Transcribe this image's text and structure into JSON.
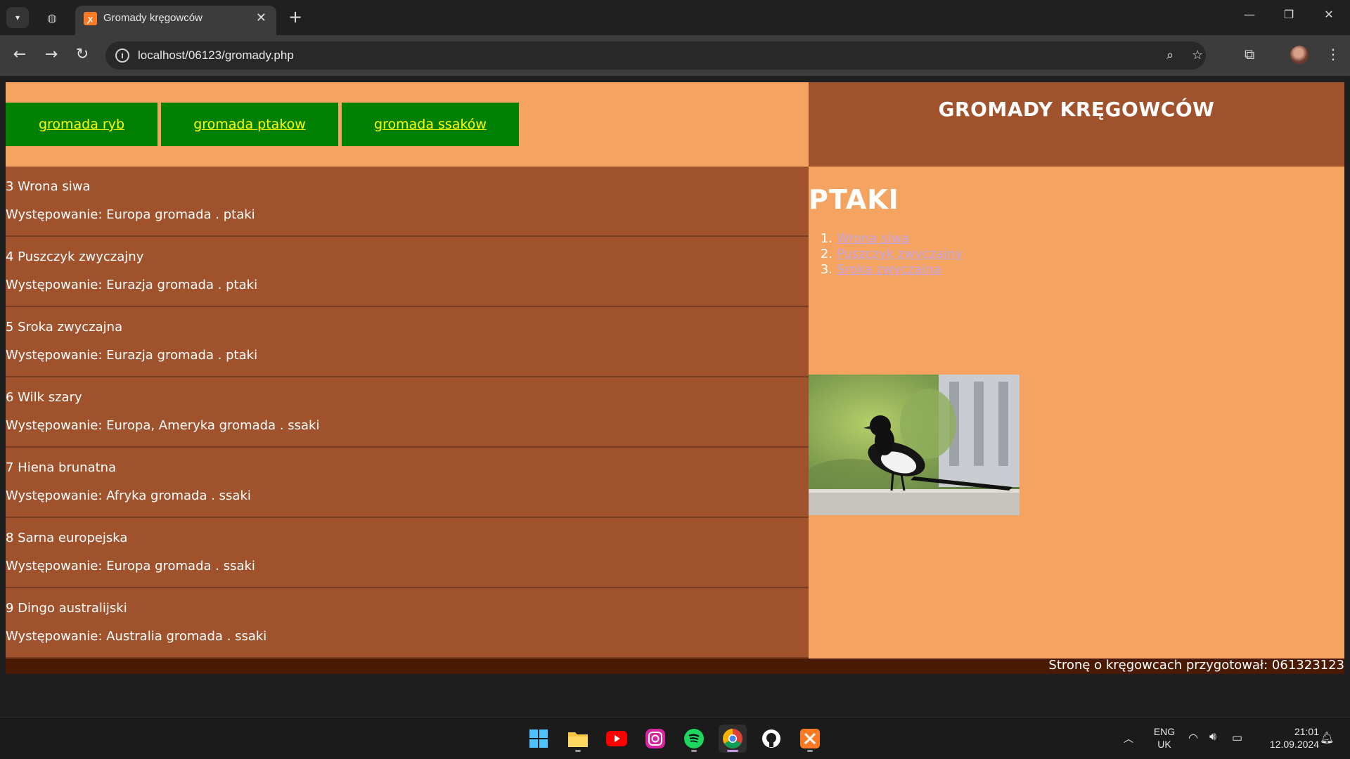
{
  "browser": {
    "tab_title": "Gromady kręgowców",
    "url": "localhost/06123/gromady.php"
  },
  "menu": [
    {
      "label": "gromada ryb"
    },
    {
      "label": "gromada ptakow"
    },
    {
      "label": "gromada ssaków"
    }
  ],
  "header": {
    "title": "GROMADY KRĘGOWCÓW"
  },
  "records": [
    {
      "name": "3 Wrona siwa",
      "desc": "Występowanie: Europa gromada . ptaki"
    },
    {
      "name": "4 Puszczyk zwyczajny",
      "desc": "Występowanie: Eurazja gromada . ptaki"
    },
    {
      "name": "5 Sroka zwyczajna",
      "desc": "Występowanie: Eurazja gromada . ptaki"
    },
    {
      "name": "6 Wilk szary",
      "desc": "Występowanie: Europa, Ameryka gromada . ssaki"
    },
    {
      "name": "7 Hiena brunatna",
      "desc": "Występowanie: Afryka gromada . ssaki"
    },
    {
      "name": "8 Sarna europejska",
      "desc": "Występowanie: Europa gromada . ssaki"
    },
    {
      "name": "9 Dingo australijski",
      "desc": "Występowanie: Australia gromada . ssaki"
    }
  ],
  "section": {
    "heading": "PTAKI",
    "items": [
      {
        "num": "1.",
        "label": "Wrona siwa"
      },
      {
        "num": "2.",
        "label": "Puszczyk zwyczajny"
      },
      {
        "num": "3.",
        "label": "Sroka zwyczajna"
      }
    ]
  },
  "footer": {
    "text": "Stronę o kręgowcach przygotował: 061323123"
  },
  "taskbar": {
    "lang_top": "ENG",
    "lang_bottom": "UK",
    "time": "21:01",
    "date": "12.09.2024"
  },
  "colors": {
    "sandy": "#f4a460",
    "sienna": "#a0522d",
    "menu_green": "#008000",
    "menu_text": "#ffff00",
    "footer": "#4a1a05"
  }
}
